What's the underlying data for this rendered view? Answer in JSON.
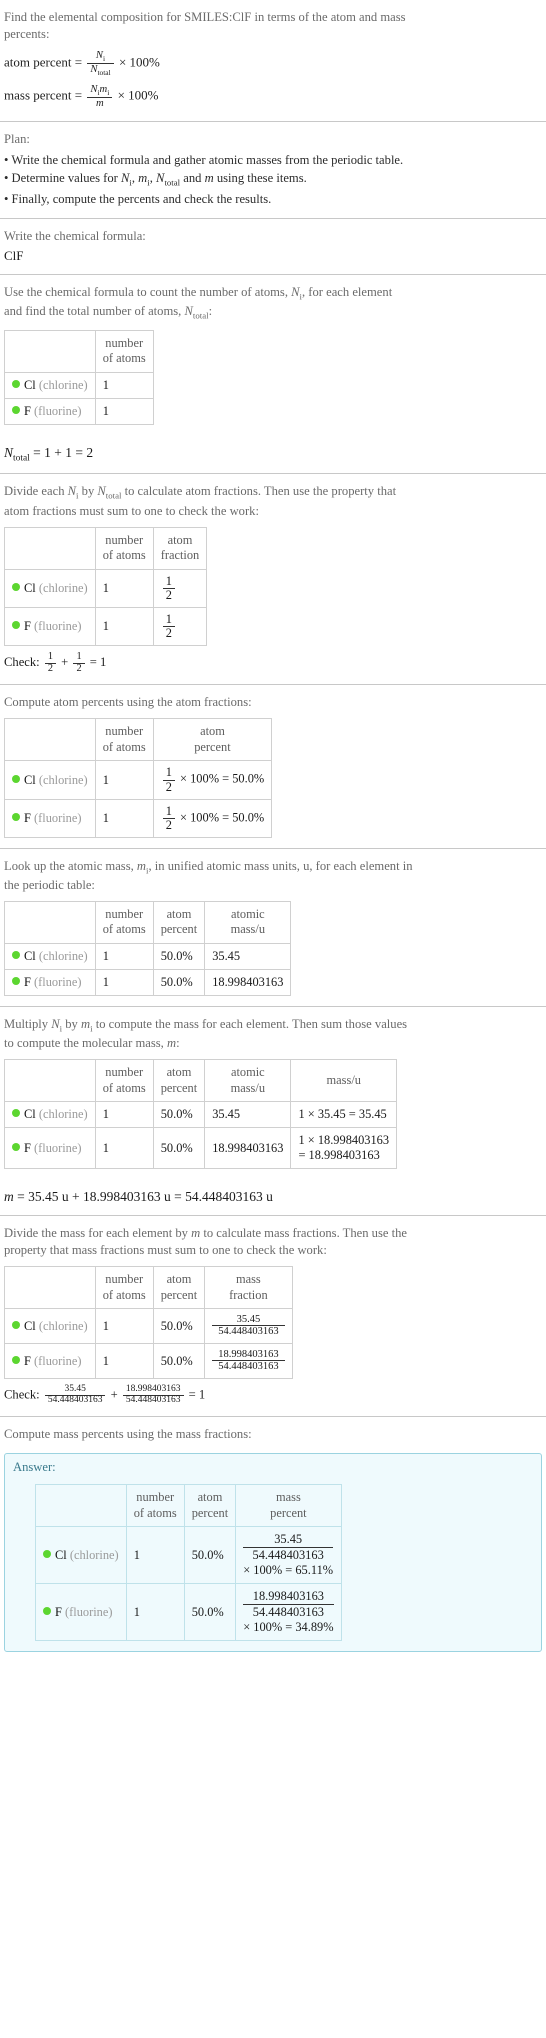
{
  "header": {
    "question_line1": "Find the elemental composition for SMILES:ClF in terms of the atom and mass",
    "question_line2": "percents:",
    "atom_percent_label": "atom percent =",
    "mass_percent_label": "mass percent =",
    "times_100": "× 100%",
    "N_i": "N",
    "N_total": "N",
    "total_sub": "total",
    "i_sub": "i",
    "m_i": "m",
    "m": "m"
  },
  "plan": {
    "title": "Plan:",
    "items": [
      "• Write the chemical formula and gather atomic masses from the periodic table.",
      "• Determine values for Ni, mi, Ntotal and m using these items.",
      "• Finally, compute the percents and check the results."
    ],
    "bullet2_pre": "• Determine values for ",
    "bullet2_mid": ", ",
    "bullet2_post": " and ",
    "bullet2_end": " using these items."
  },
  "formula_section": {
    "prompt": "Write the chemical formula:",
    "formula": "ClF"
  },
  "count_section": {
    "prompt_line1": "Use the chemical formula to count the number of atoms, Ni, for each element",
    "prompt_line2": "and find the total number of atoms, Ntotal:",
    "headers": [
      "",
      "number of atoms"
    ],
    "header_number": "number",
    "header_of_atoms": "of atoms",
    "rows": [
      {
        "symbol": "Cl",
        "name": "(chlorine)",
        "color": "#5cd630",
        "atoms": "1"
      },
      {
        "symbol": "F",
        "name": "(fluorine)",
        "color": "#5cd630",
        "atoms": "1"
      }
    ],
    "total_expr": "= 1 + 1 = 2"
  },
  "fraction_section": {
    "prompt_line1": "Divide each Ni by Ntotal to calculate atom fractions. Then use the property that",
    "prompt_line2": "atom fractions must sum to one to check the work:",
    "header_number": "number",
    "header_of_atoms": "of atoms",
    "header_atom": "atom",
    "header_fraction": "fraction",
    "rows": [
      {
        "symbol": "Cl",
        "name": "(chlorine)",
        "atoms": "1",
        "frac_num": "1",
        "frac_den": "2"
      },
      {
        "symbol": "F",
        "name": "(fluorine)",
        "atoms": "1",
        "frac_num": "1",
        "frac_den": "2"
      }
    ],
    "check_label": "Check:",
    "check_plus": "+",
    "check_equals": "= 1",
    "check_f1_num": "1",
    "check_f1_den": "2",
    "check_f2_num": "1",
    "check_f2_den": "2"
  },
  "atom_percent_section": {
    "prompt": "Compute atom percents using the atom fractions:",
    "header_number": "number",
    "header_of_atoms": "of atoms",
    "header_atom": "atom",
    "header_percent": "percent",
    "rows": [
      {
        "symbol": "Cl",
        "name": "(chlorine)",
        "atoms": "1",
        "frac_num": "1",
        "frac_den": "2",
        "expr": "× 100% = 50.0%"
      },
      {
        "symbol": "F",
        "name": "(fluorine)",
        "atoms": "1",
        "frac_num": "1",
        "frac_den": "2",
        "expr": "× 100% = 50.0%"
      }
    ]
  },
  "atomic_mass_section": {
    "prompt_line1": "Look up the atomic mass, mi, in unified atomic mass units, u, for each element in",
    "prompt_line2": "the periodic table:",
    "header_number": "number",
    "header_of_atoms": "of atoms",
    "header_atom": "atom",
    "header_percent": "percent",
    "header_atomic": "atomic",
    "header_massu": "mass/u",
    "rows": [
      {
        "symbol": "Cl",
        "name": "(chlorine)",
        "atoms": "1",
        "percent": "50.0%",
        "mass": "35.45"
      },
      {
        "symbol": "F",
        "name": "(fluorine)",
        "atoms": "1",
        "percent": "50.0%",
        "mass": "18.998403163"
      }
    ]
  },
  "molecular_mass_section": {
    "prompt_line1": "Multiply Ni by mi to compute the mass for each element. Then sum those values",
    "prompt_line2": "to compute the molecular mass, m:",
    "header_number": "number",
    "header_of_atoms": "of atoms",
    "header_atom": "atom",
    "header_percent": "percent",
    "header_atomic": "atomic",
    "header_atomic_massu": "mass/u",
    "header_massu": "mass/u",
    "rows": [
      {
        "symbol": "Cl",
        "name": "(chlorine)",
        "atoms": "1",
        "percent": "50.0%",
        "atomic_mass": "35.45",
        "mass_expr": "1 × 35.45 = 35.45",
        "mass_expr2": ""
      },
      {
        "symbol": "F",
        "name": "(fluorine)",
        "atoms": "1",
        "percent": "50.0%",
        "atomic_mass": "18.998403163",
        "mass_expr": "1 × 18.998403163",
        "mass_expr2": "= 18.998403163"
      }
    ],
    "m_total_expr": "= 35.45 u + 18.998403163 u = 54.448403163 u"
  },
  "mass_fraction_section": {
    "prompt_line1": "Divide the mass for each element by m to calculate mass fractions. Then use the",
    "prompt_line2": "property that mass fractions must sum to one to check the work:",
    "header_number": "number",
    "header_of_atoms": "of atoms",
    "header_atom": "atom",
    "header_percent": "percent",
    "header_mass": "mass",
    "header_fraction": "fraction",
    "rows": [
      {
        "symbol": "Cl",
        "name": "(chlorine)",
        "atoms": "1",
        "percent": "50.0%",
        "num": "35.45",
        "den": "54.448403163"
      },
      {
        "symbol": "F",
        "name": "(fluorine)",
        "atoms": "1",
        "percent": "50.0%",
        "num": "18.998403163",
        "den": "54.448403163"
      }
    ],
    "check_label": "Check:",
    "check_f1_num": "35.45",
    "check_f1_den": "54.448403163",
    "check_plus": "+",
    "check_f2_num": "18.998403163",
    "check_f2_den": "54.448403163",
    "check_equals": "= 1"
  },
  "mass_percent_section": {
    "prompt": "Compute mass percents using the mass fractions:",
    "answer_label": "Answer:",
    "header_number": "number",
    "header_of_atoms": "of atoms",
    "header_atom": "atom",
    "header_percent": "percent",
    "header_mass": "mass",
    "header_mass_percent": "percent",
    "rows": [
      {
        "symbol": "Cl",
        "name": "(chlorine)",
        "atoms": "1",
        "percent": "50.0%",
        "num": "35.45",
        "den": "54.448403163",
        "tail": "× 100% = 65.11%"
      },
      {
        "symbol": "F",
        "name": "(fluorine)",
        "atoms": "1",
        "percent": "50.0%",
        "num": "18.998403163",
        "den": "54.448403163",
        "tail": "× 100% = 34.89%"
      }
    ]
  },
  "colors": {
    "element_dot": "#5cd630",
    "answer_bg": "#effafd",
    "answer_border": "#9bd3e0",
    "rule": "#c8c8c8"
  }
}
